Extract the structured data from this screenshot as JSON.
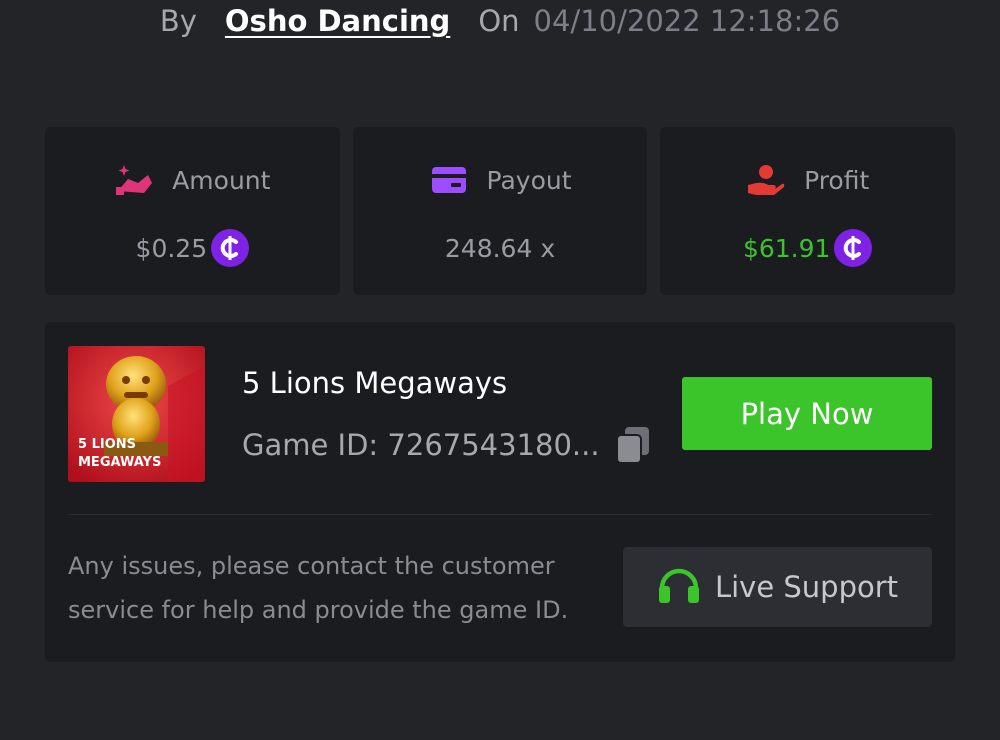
{
  "header": {
    "by_label": "By",
    "username": "Osho Dancing",
    "on_label": "On",
    "datetime": "04/10/2022 12:18:26"
  },
  "stats": {
    "amount": {
      "label": "Amount",
      "value": "$0.25",
      "icon": "money-hand-icon",
      "color": "#e0347a"
    },
    "payout": {
      "label": "Payout",
      "value": "248.64 x",
      "icon": "card-icon",
      "color": "#9b4dff"
    },
    "profit": {
      "label": "Profit",
      "value": "$61.91",
      "icon": "hand-coin-icon",
      "color": "#e53935"
    },
    "coin_symbol": "₵"
  },
  "game": {
    "title": "5 Lions Megaways",
    "game_id": "Game ID: 7267543180...",
    "thumb_line1": "5 LIONS",
    "thumb_line2": "MEGAWAYS",
    "play_label": "Play Now"
  },
  "support": {
    "help_text": "Any issues, please contact the customer service for help and provide the game ID.",
    "button_label": "Live Support"
  },
  "colors": {
    "background": "#232428",
    "card": "#1b1c20",
    "accent_green": "#3cc52b",
    "coin_purple": "#7e22e6"
  }
}
